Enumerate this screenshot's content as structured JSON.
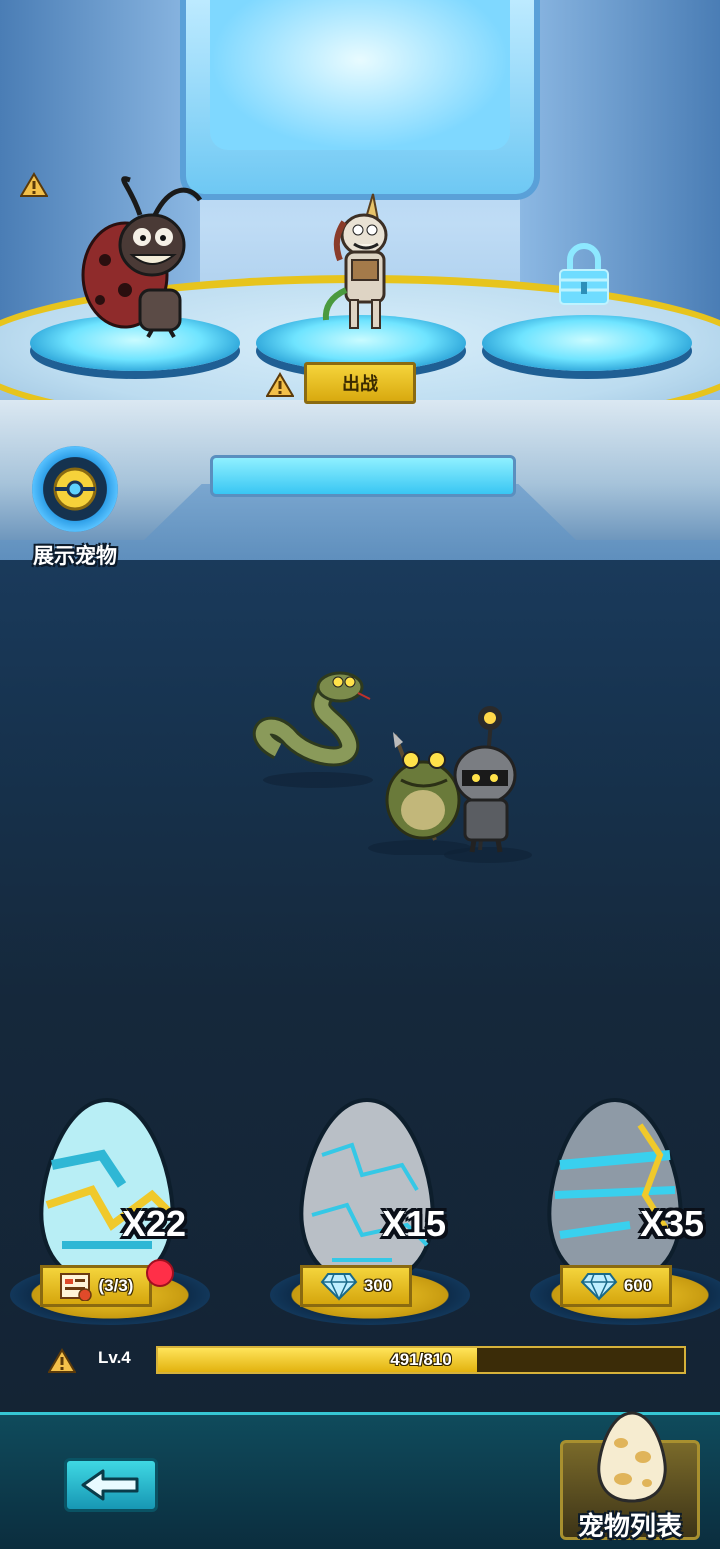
{
  "pedestals": {
    "deploy_label": "出战",
    "slots": [
      {
        "creature": "ladybug",
        "state": "occupied"
      },
      {
        "creature": "unicorn",
        "state": "deployed"
      },
      {
        "creature": "none",
        "state": "locked"
      }
    ]
  },
  "showcase": {
    "label": "展示宠物"
  },
  "field_creatures": [
    "snake",
    "toad",
    "knight"
  ],
  "eggs": [
    {
      "count": "X22",
      "cost": "(3/3)",
      "currency": "ticket-icon",
      "notification": true
    },
    {
      "count": "X15",
      "cost": "300",
      "currency": "diamond-icon",
      "notification": false
    },
    {
      "count": "X35",
      "cost": "600",
      "currency": "diamond-icon",
      "notification": false
    }
  ],
  "level": {
    "label": "Lv.4",
    "progress_text": "491/810",
    "current": 491,
    "max": 810
  },
  "nav": {
    "pet_list_label": "宠物列表"
  },
  "colors": {
    "accent_gold": "#f2cf2a",
    "accent_cyan": "#39c6f3",
    "alert_red": "#ff2f48"
  }
}
